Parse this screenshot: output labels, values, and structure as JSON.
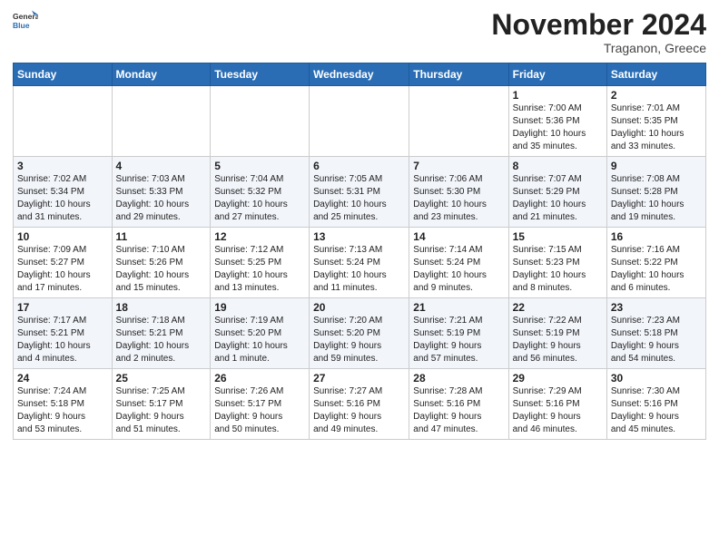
{
  "header": {
    "logo_line1": "General",
    "logo_line2": "Blue",
    "month": "November 2024",
    "location": "Traganon, Greece"
  },
  "weekdays": [
    "Sunday",
    "Monday",
    "Tuesday",
    "Wednesday",
    "Thursday",
    "Friday",
    "Saturday"
  ],
  "weeks": [
    [
      {
        "day": "",
        "info": ""
      },
      {
        "day": "",
        "info": ""
      },
      {
        "day": "",
        "info": ""
      },
      {
        "day": "",
        "info": ""
      },
      {
        "day": "",
        "info": ""
      },
      {
        "day": "1",
        "info": "Sunrise: 7:00 AM\nSunset: 5:36 PM\nDaylight: 10 hours\nand 35 minutes."
      },
      {
        "day": "2",
        "info": "Sunrise: 7:01 AM\nSunset: 5:35 PM\nDaylight: 10 hours\nand 33 minutes."
      }
    ],
    [
      {
        "day": "3",
        "info": "Sunrise: 7:02 AM\nSunset: 5:34 PM\nDaylight: 10 hours\nand 31 minutes."
      },
      {
        "day": "4",
        "info": "Sunrise: 7:03 AM\nSunset: 5:33 PM\nDaylight: 10 hours\nand 29 minutes."
      },
      {
        "day": "5",
        "info": "Sunrise: 7:04 AM\nSunset: 5:32 PM\nDaylight: 10 hours\nand 27 minutes."
      },
      {
        "day": "6",
        "info": "Sunrise: 7:05 AM\nSunset: 5:31 PM\nDaylight: 10 hours\nand 25 minutes."
      },
      {
        "day": "7",
        "info": "Sunrise: 7:06 AM\nSunset: 5:30 PM\nDaylight: 10 hours\nand 23 minutes."
      },
      {
        "day": "8",
        "info": "Sunrise: 7:07 AM\nSunset: 5:29 PM\nDaylight: 10 hours\nand 21 minutes."
      },
      {
        "day": "9",
        "info": "Sunrise: 7:08 AM\nSunset: 5:28 PM\nDaylight: 10 hours\nand 19 minutes."
      }
    ],
    [
      {
        "day": "10",
        "info": "Sunrise: 7:09 AM\nSunset: 5:27 PM\nDaylight: 10 hours\nand 17 minutes."
      },
      {
        "day": "11",
        "info": "Sunrise: 7:10 AM\nSunset: 5:26 PM\nDaylight: 10 hours\nand 15 minutes."
      },
      {
        "day": "12",
        "info": "Sunrise: 7:12 AM\nSunset: 5:25 PM\nDaylight: 10 hours\nand 13 minutes."
      },
      {
        "day": "13",
        "info": "Sunrise: 7:13 AM\nSunset: 5:24 PM\nDaylight: 10 hours\nand 11 minutes."
      },
      {
        "day": "14",
        "info": "Sunrise: 7:14 AM\nSunset: 5:24 PM\nDaylight: 10 hours\nand 9 minutes."
      },
      {
        "day": "15",
        "info": "Sunrise: 7:15 AM\nSunset: 5:23 PM\nDaylight: 10 hours\nand 8 minutes."
      },
      {
        "day": "16",
        "info": "Sunrise: 7:16 AM\nSunset: 5:22 PM\nDaylight: 10 hours\nand 6 minutes."
      }
    ],
    [
      {
        "day": "17",
        "info": "Sunrise: 7:17 AM\nSunset: 5:21 PM\nDaylight: 10 hours\nand 4 minutes."
      },
      {
        "day": "18",
        "info": "Sunrise: 7:18 AM\nSunset: 5:21 PM\nDaylight: 10 hours\nand 2 minutes."
      },
      {
        "day": "19",
        "info": "Sunrise: 7:19 AM\nSunset: 5:20 PM\nDaylight: 10 hours\nand 1 minute."
      },
      {
        "day": "20",
        "info": "Sunrise: 7:20 AM\nSunset: 5:20 PM\nDaylight: 9 hours\nand 59 minutes."
      },
      {
        "day": "21",
        "info": "Sunrise: 7:21 AM\nSunset: 5:19 PM\nDaylight: 9 hours\nand 57 minutes."
      },
      {
        "day": "22",
        "info": "Sunrise: 7:22 AM\nSunset: 5:19 PM\nDaylight: 9 hours\nand 56 minutes."
      },
      {
        "day": "23",
        "info": "Sunrise: 7:23 AM\nSunset: 5:18 PM\nDaylight: 9 hours\nand 54 minutes."
      }
    ],
    [
      {
        "day": "24",
        "info": "Sunrise: 7:24 AM\nSunset: 5:18 PM\nDaylight: 9 hours\nand 53 minutes."
      },
      {
        "day": "25",
        "info": "Sunrise: 7:25 AM\nSunset: 5:17 PM\nDaylight: 9 hours\nand 51 minutes."
      },
      {
        "day": "26",
        "info": "Sunrise: 7:26 AM\nSunset: 5:17 PM\nDaylight: 9 hours\nand 50 minutes."
      },
      {
        "day": "27",
        "info": "Sunrise: 7:27 AM\nSunset: 5:16 PM\nDaylight: 9 hours\nand 49 minutes."
      },
      {
        "day": "28",
        "info": "Sunrise: 7:28 AM\nSunset: 5:16 PM\nDaylight: 9 hours\nand 47 minutes."
      },
      {
        "day": "29",
        "info": "Sunrise: 7:29 AM\nSunset: 5:16 PM\nDaylight: 9 hours\nand 46 minutes."
      },
      {
        "day": "30",
        "info": "Sunrise: 7:30 AM\nSunset: 5:16 PM\nDaylight: 9 hours\nand 45 minutes."
      }
    ]
  ],
  "colors": {
    "header_bg": "#2a6db5",
    "row_even": "#f2f5fa",
    "row_odd": "#ffffff"
  }
}
